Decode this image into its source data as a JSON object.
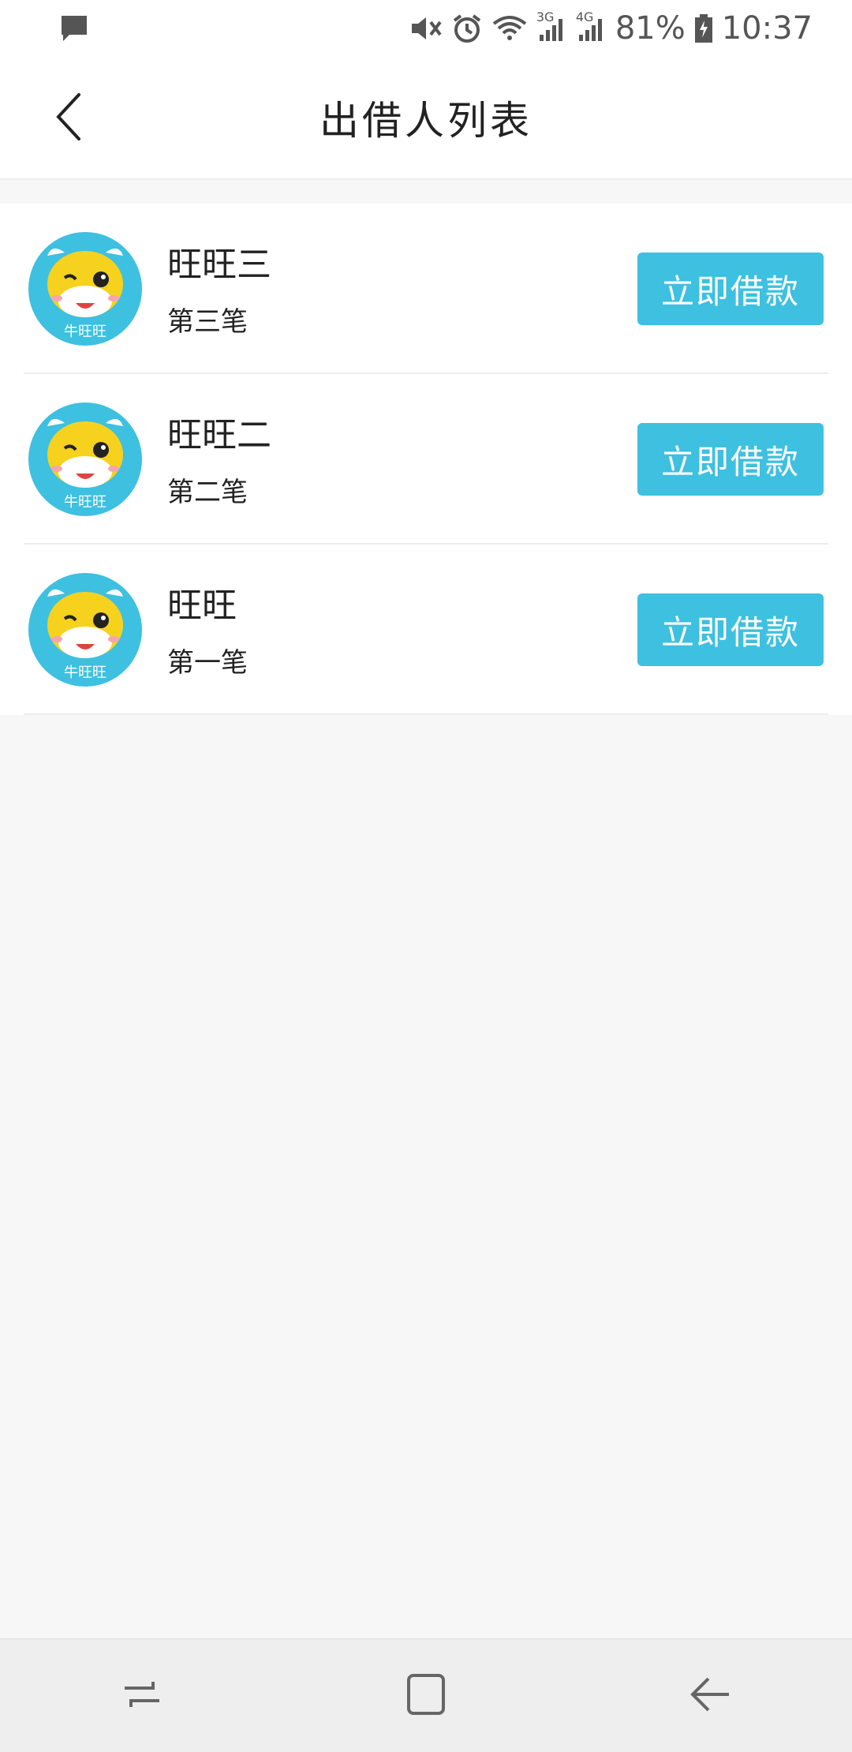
{
  "status_bar": {
    "notification_icon": "message-icon",
    "icons": [
      "mute-icon",
      "alarm-icon",
      "wifi-icon",
      "signal-3g-icon",
      "signal-4g-icon",
      "battery-icon"
    ],
    "net1": "3G",
    "net2": "4G",
    "battery": "81%",
    "time": "10:37"
  },
  "header": {
    "back_icon": "chevron-left-icon",
    "title": "出借人列表"
  },
  "lenders": [
    {
      "name": "旺旺三",
      "sub": "第三笔",
      "button": "立即借款",
      "avatar_text": "牛旺旺"
    },
    {
      "name": "旺旺二",
      "sub": "第二笔",
      "button": "立即借款",
      "avatar_text": "牛旺旺"
    },
    {
      "name": "旺旺",
      "sub": "第一笔",
      "button": "立即借款",
      "avatar_text": "牛旺旺"
    }
  ],
  "nav": [
    "recent-apps-icon",
    "home-icon",
    "back-icon"
  ],
  "colors": {
    "accent": "#3ec0e0",
    "avatar_bg": "#3ec0e0",
    "mascot": "#f6d21f"
  }
}
